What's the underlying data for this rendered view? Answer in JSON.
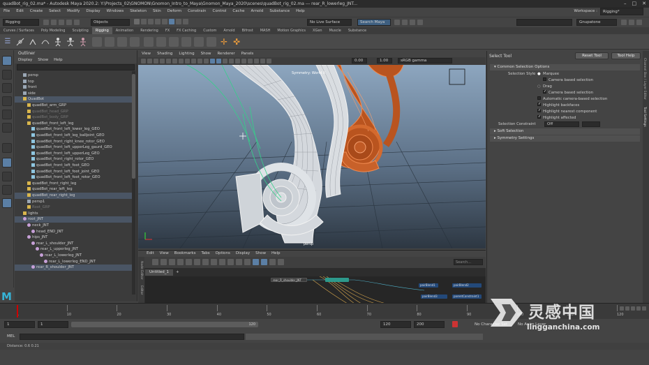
{
  "window": {
    "title": "quadBot_rig_02.ma* - Autodesk Maya 2020.2: Y:\\Projects_02\\GNOMON\\Gnomon_Intro_to_Maya\\Gnomon_Maya_2020\\scenes\\quadBot_rig_02.ma  ---  rear_R_lowerleg_JNT...",
    "controls": [
      "–",
      "□",
      "✕"
    ]
  },
  "menubar": [
    "File",
    "Edit",
    "Create",
    "Select",
    "Modify",
    "Display",
    "Windows",
    "Skeleton",
    "Skin",
    "Deform",
    "Constrain",
    "Control",
    "Cache",
    "Arnold",
    "Substance",
    "Help"
  ],
  "workspace": {
    "label": "Workspace :",
    "value": "Rigging*"
  },
  "statusline": {
    "menuset": "Rigging",
    "objects": "Objects",
    "live_surface": "No Live Surface",
    "search": "Search Maya",
    "user": "Gnupatone"
  },
  "shelf_tabs": [
    "Curves / Surfaces",
    "Poly Modeling",
    "Sculpting",
    "Rigging",
    "Animation",
    "Rendering",
    "FX",
    "FX Caching",
    "Custom",
    "Arnold",
    "Bifrost",
    "MASH",
    "Motion Graphics",
    "XGen",
    "Muscle",
    "Substance"
  ],
  "shelf_active": "Rigging",
  "outliner": {
    "title": "Outliner",
    "menus": [
      "Display",
      "Show",
      "Help"
    ],
    "rows": [
      {
        "t": "persp",
        "d": 1,
        "ic": "cam"
      },
      {
        "t": "top",
        "d": 1,
        "ic": "cam"
      },
      {
        "t": "front",
        "d": 1,
        "ic": "cam"
      },
      {
        "t": "side",
        "d": 1,
        "ic": "cam"
      },
      {
        "t": "QuadBot",
        "d": 1,
        "ic": "grp",
        "hl": true
      },
      {
        "t": "quadBot_arm_GRP",
        "d": 2,
        "ic": "grp"
      },
      {
        "t": "quadBot_head_GRP",
        "d": 2,
        "ic": "grp",
        "dim": true
      },
      {
        "t": "quadBot_body_GRP",
        "d": 2,
        "ic": "grp",
        "dim": true
      },
      {
        "t": "quadBot_front_left_leg",
        "d": 2,
        "ic": "grp"
      },
      {
        "t": "quadBot_front_left_lower_leg_GEO",
        "d": 3,
        "ic": "geo"
      },
      {
        "t": "quadBot_front_left_leg_balljoint_GEO",
        "d": 3,
        "ic": "geo"
      },
      {
        "t": "quadBot_front_right_knee_rotor_GEO",
        "d": 3,
        "ic": "geo"
      },
      {
        "t": "quadBot_front_left_upperLeg_gaurd_GEO",
        "d": 3,
        "ic": "geo"
      },
      {
        "t": "quadBot_front_left_upperLeg_GEO",
        "d": 3,
        "ic": "geo"
      },
      {
        "t": "quadBot_front_right_rotor_GEO",
        "d": 3,
        "ic": "geo"
      },
      {
        "t": "quadBot_front_left_foot_GEO",
        "d": 3,
        "ic": "geo"
      },
      {
        "t": "quadBot_front_left_foot_joint_GEO",
        "d": 3,
        "ic": "geo"
      },
      {
        "t": "quadBot_front_left_foot_rotor_GEO",
        "d": 3,
        "ic": "geo"
      },
      {
        "t": "quadBot_front_right_leg",
        "d": 2,
        "ic": "grp"
      },
      {
        "t": "quadBot_rear_left_leg",
        "d": 2,
        "ic": "grp"
      },
      {
        "t": "quadBot_rear_right_leg",
        "d": 2,
        "ic": "grp",
        "hl": true
      },
      {
        "t": "persp1",
        "d": 2,
        "ic": "cam"
      },
      {
        "t": "Root_GRP",
        "d": 2,
        "ic": "grp",
        "dim": true
      },
      {
        "t": "lights",
        "d": 1,
        "ic": "grp"
      },
      {
        "t": "root_JNT",
        "d": 1,
        "ic": "jnt",
        "hl": true
      },
      {
        "t": "neck_JNT",
        "d": 2,
        "ic": "jnt"
      },
      {
        "t": "head_END_JNT",
        "d": 3,
        "ic": "jnt"
      },
      {
        "t": "hips_JNT",
        "d": 2,
        "ic": "jnt"
      },
      {
        "t": "rear_L_shoulder_JNT",
        "d": 3,
        "ic": "jnt"
      },
      {
        "t": "rear_L_upperleg_JNT",
        "d": 4,
        "ic": "jnt"
      },
      {
        "t": "rear_L_lowerleg_JNT",
        "d": 5,
        "ic": "jnt"
      },
      {
        "t": "rear_L_lowerleg_END_JNT",
        "d": 6,
        "ic": "jnt"
      },
      {
        "t": "rear_R_shoulder_JNT",
        "d": 3,
        "ic": "jnt",
        "hl": true
      }
    ]
  },
  "viewport": {
    "menus": [
      "View",
      "Shading",
      "Lighting",
      "Show",
      "Renderer",
      "Panels"
    ],
    "exposure": "0.00",
    "gamma": "1.00",
    "colorspace": "sRGB gamma",
    "symmetry": "Symmetry: World X",
    "camera": "persp"
  },
  "node_editor": {
    "menus": [
      "Edit",
      "View",
      "Bookmarks",
      "Tabs",
      "Options",
      "Display",
      "Show",
      "Help"
    ],
    "tab": "Untitled_1",
    "tab_add": "+",
    "search_placeholder": "Search...",
    "side_label": "Node Editor",
    "side_label2": "Editor",
    "node_labels": [
      "rear_R_shoulder_JNT",
      "rear_R_...",
      "pairBlend1",
      "pairBlend2",
      "pairBlend3",
      "parentConstraint1",
      "nodeFG1",
      "nodeFG2"
    ]
  },
  "tool_settings": {
    "title": "Select Tool",
    "reset": "Reset Tool",
    "help": "Tool Help",
    "sections": [
      "Common Selection Options",
      "Soft Selection",
      "Symmetry Settings"
    ],
    "selection_style_label": "Selection Style",
    "marquee": "Marquee",
    "camera_based": "Camera based selection",
    "drag": "Drag",
    "camera_based2": "Camera based selection",
    "auto_camera": "Automatic camera-based selection",
    "highlight_backfaces": "Highlight backfaces",
    "highlight_nearest": "Highlight nearest component",
    "highlight_affected": "Highlight affected",
    "constraint_label": "Selection Constraint",
    "constraint_value": "Off",
    "side_tabs": [
      "Channel Box / Layer Editor",
      "Tool Settings"
    ]
  },
  "timeline": {
    "ticks": [
      "1",
      "10",
      "20",
      "30",
      "40",
      "50",
      "60",
      "70",
      "80",
      "90",
      "100",
      "110",
      "120"
    ],
    "current": "1"
  },
  "range": {
    "start": "1",
    "inner_start": "1",
    "inner_end": "120",
    "end_a": "120",
    "end_b": "200",
    "char_set": "No Character Set",
    "anim_layer": "No Anim Layer",
    "fps": "24 fps"
  },
  "mel": {
    "label": "MEL"
  },
  "help_line": "Distance: 0.6   0.21",
  "watermark": {
    "cn": "灵感中国",
    "url": "lingganchina.com"
  },
  "colors": {
    "select_blue": "#5b7fa5",
    "orange_mesh": "#c7511f",
    "wire_white": "#e8e8e8",
    "joint_green": "#35d08a"
  }
}
